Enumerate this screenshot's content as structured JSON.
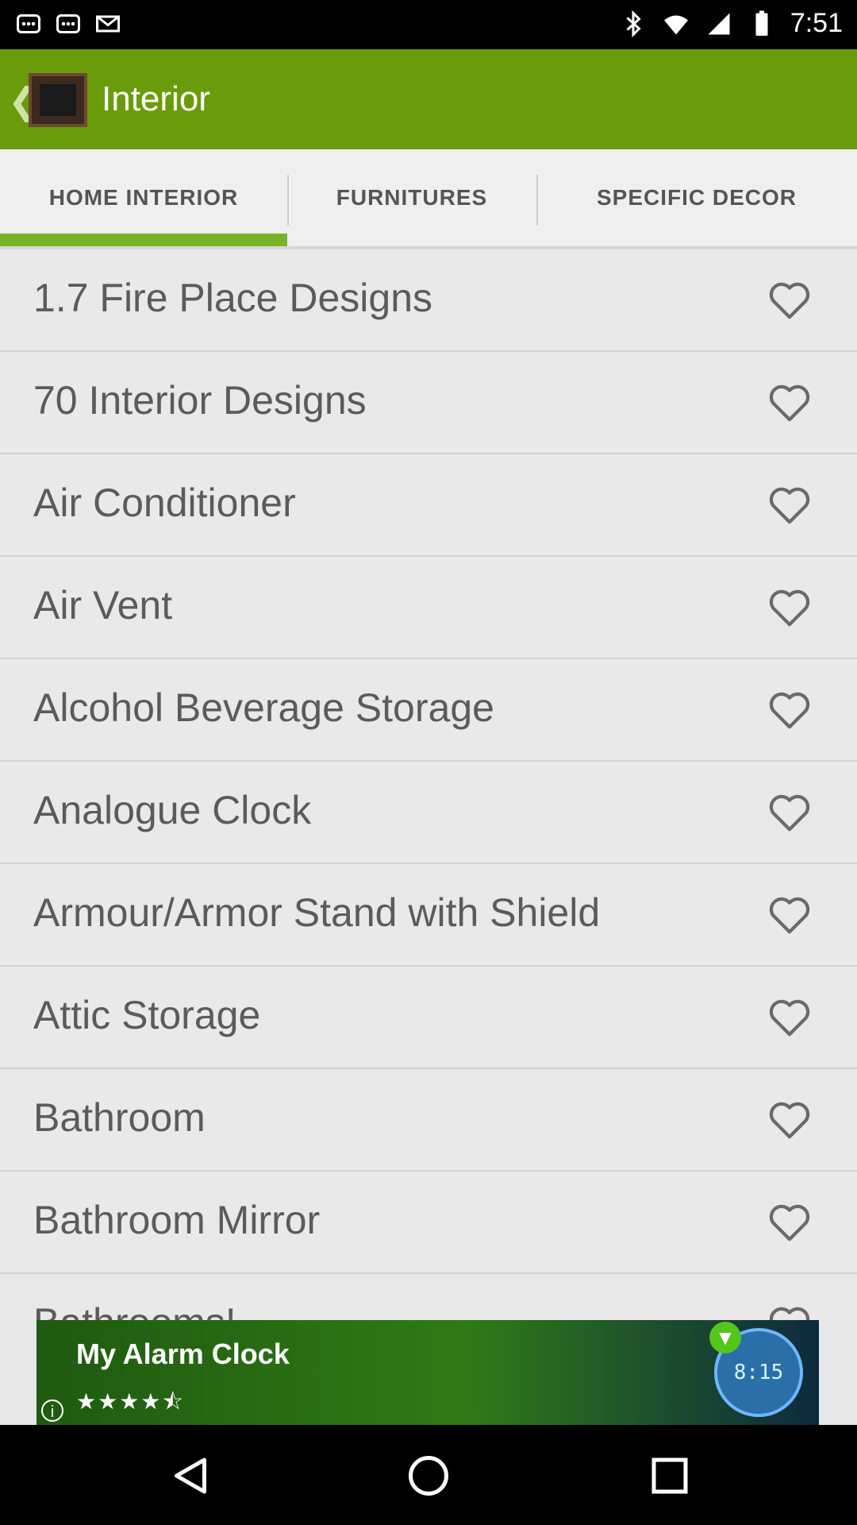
{
  "status_bar": {
    "time": "7:51"
  },
  "app_bar": {
    "title": "Interior"
  },
  "tabs": [
    {
      "label": "HOME INTERIOR",
      "selected": true
    },
    {
      "label": "FURNITURES",
      "selected": false
    },
    {
      "label": "SPECIFIC DECOR",
      "selected": false
    }
  ],
  "items": [
    {
      "label": "1.7 Fire Place Designs"
    },
    {
      "label": "70 Interior Designs"
    },
    {
      "label": "Air Conditioner"
    },
    {
      "label": "Air Vent"
    },
    {
      "label": "Alcohol Beverage Storage"
    },
    {
      "label": "Analogue Clock"
    },
    {
      "label": "Armour/Armor Stand with Shield"
    },
    {
      "label": "Attic Storage"
    },
    {
      "label": "Bathroom"
    },
    {
      "label": "Bathroom Mirror"
    },
    {
      "label": "Bathrooms!"
    }
  ],
  "ad": {
    "title": "My Alarm Clock",
    "clock_time": "8:15",
    "rating_stars": "★★★★⯪"
  },
  "colors": {
    "app_bar": "#6a9b0a",
    "tab_indicator": "#7ab32a"
  }
}
